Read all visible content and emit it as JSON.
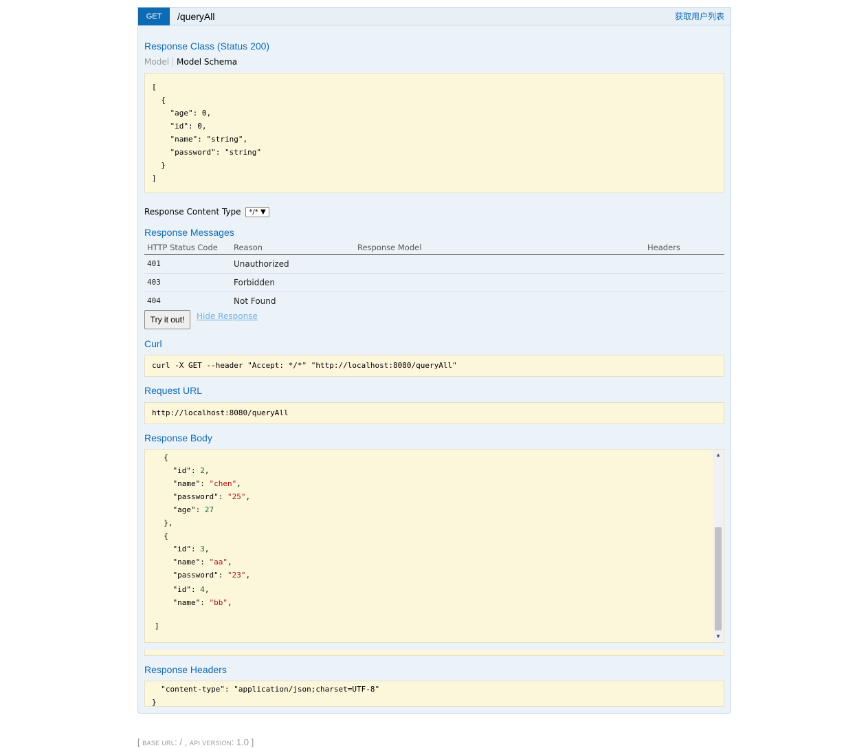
{
  "operation": {
    "method": "GET",
    "path": "/queryAll",
    "summary": "获取用户列表"
  },
  "response_class": {
    "title": "Response Class (Status 200)",
    "tab_model": "Model",
    "tab_schema": "Model Schema",
    "schema_lines": [
      "[",
      "  {",
      "    \"age\": 0,",
      "    \"id\": 0,",
      "    \"name\": \"string\",",
      "    \"password\": \"string\"",
      "  }",
      "]"
    ]
  },
  "response_content_type": {
    "label": "Response Content Type",
    "selected": "*/*"
  },
  "response_messages": {
    "title": "Response Messages",
    "columns": [
      "HTTP Status Code",
      "Reason",
      "Response Model",
      "Headers"
    ],
    "rows": [
      {
        "code": "401",
        "reason": "Unauthorized",
        "model": "",
        "headers": ""
      },
      {
        "code": "403",
        "reason": "Forbidden",
        "model": "",
        "headers": ""
      },
      {
        "code": "404",
        "reason": "Not Found",
        "model": "",
        "headers": ""
      }
    ]
  },
  "actions": {
    "try_label": "Try it out!",
    "hide_label": "Hide Response"
  },
  "curl": {
    "title": "Curl",
    "command": "curl -X GET --header \"Accept: */*\" \"http://localhost:8080/queryAll\""
  },
  "request_url": {
    "title": "Request URL",
    "url": "http://localhost:8080/queryAll"
  },
  "response_body": {
    "title": "Response Body"
  },
  "response_headers": {
    "title": "Response Headers",
    "line1": "  \"content-type\": \"application/json;charset=UTF-8\"",
    "line2": "}"
  },
  "footer": {
    "base_url_label": "BASE URL",
    "base_url_value": "/",
    "api_version_label": "API VERSION",
    "api_version_value": "1.0"
  }
}
